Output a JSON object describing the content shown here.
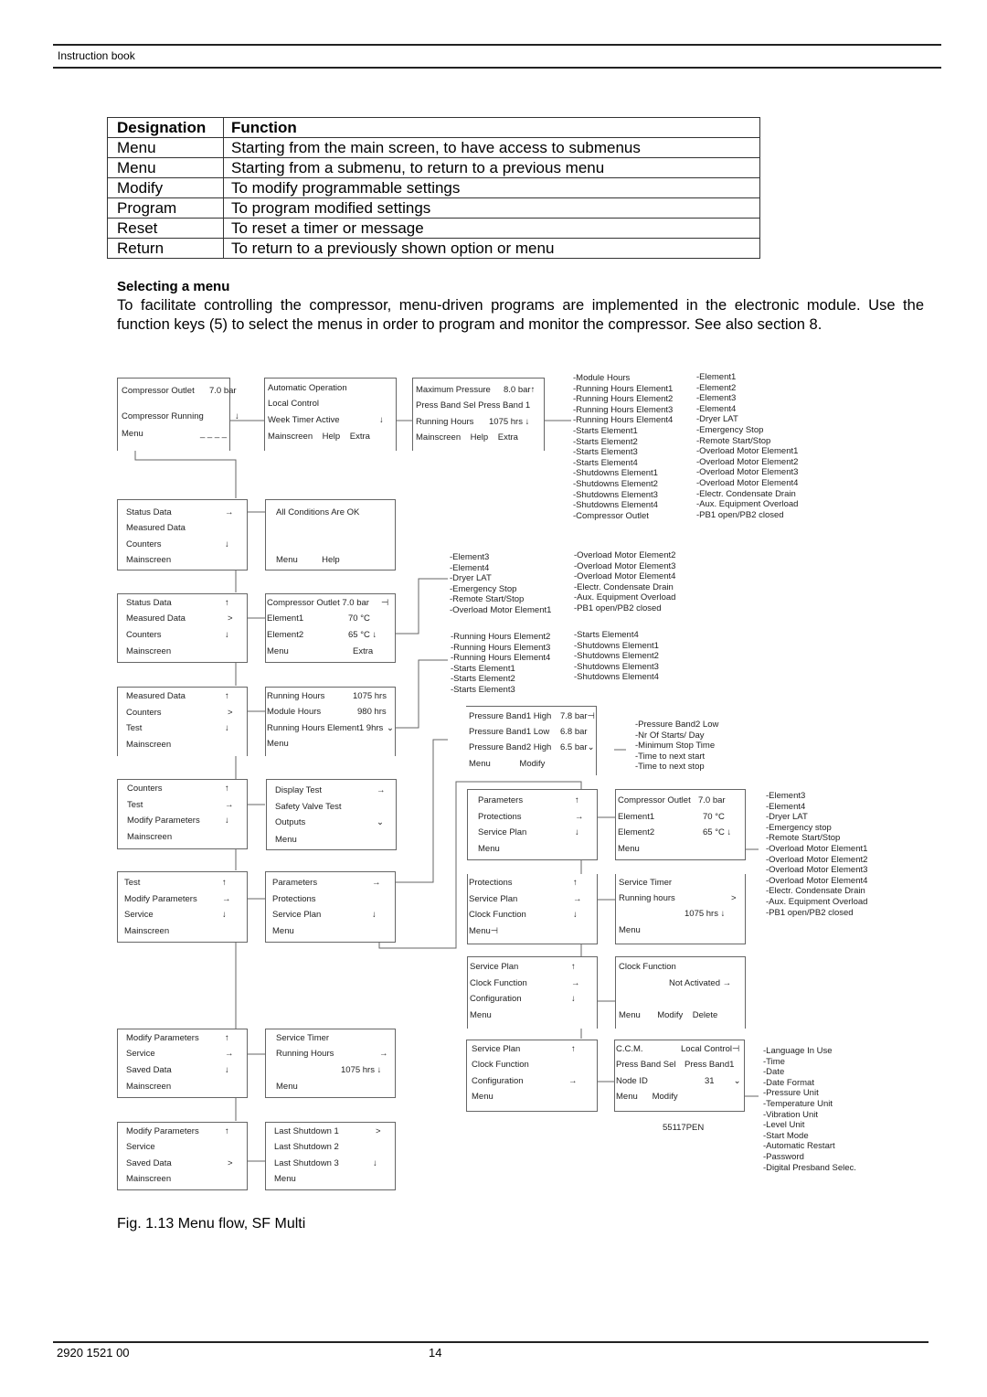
{
  "header": {
    "title": "Instruction book"
  },
  "function_table": {
    "columns": [
      "Designation",
      "Function"
    ],
    "rows": [
      [
        "Menu",
        "Starting from the main screen, to have access to submenus"
      ],
      [
        "Menu",
        "Starting from a submenu, to return to a previous menu"
      ],
      [
        "Modify",
        "To modify programmable settings"
      ],
      [
        "Program",
        "To program modified settings"
      ],
      [
        "Reset",
        "To reset a timer or message"
      ],
      [
        "Return",
        "To return to a previously shown option or menu"
      ]
    ]
  },
  "section": {
    "title": "Selecting a menu",
    "body": "To facilitate controlling the compressor, menu-driven programs are implemented in the electronic module. Use the function keys (5) to select the menus in order to program and monitor the compressor.  See also section 8."
  },
  "diagram": {
    "screens": {
      "main": [
        [
          "Compressor Outlet",
          "7.0 bar"
        ],
        [
          "",
          ""
        ],
        [
          "Compressor Running",
          "↓"
        ],
        [
          "Menu",
          "_ _ _ _"
        ]
      ],
      "auto_op": [
        [
          "Automatic  Operation",
          ""
        ],
        [
          "Local Control",
          ""
        ],
        [
          "Week Timer Active",
          "↓"
        ],
        [
          "Mainscreen    Help    Extra",
          ""
        ]
      ],
      "max_pressure": [
        [
          "Maximum Pressure",
          "8.0 bar↑"
        ],
        [
          "Press Band Sel  Press Band 1",
          ""
        ],
        [
          "Running Hours",
          "1075 hrs  ↓"
        ],
        [
          "Mainscreen    Help    Extra",
          ""
        ]
      ],
      "status_menu": [
        [
          "Status Data",
          "→"
        ],
        [
          "Measured Data",
          ""
        ],
        [
          "Counters",
          "↓"
        ],
        [
          "Mainscreen",
          ""
        ]
      ],
      "all_ok": [
        [
          "All Conditions Are OK",
          ""
        ],
        [
          "",
          ""
        ],
        [
          "",
          ""
        ],
        [
          "Menu          Help",
          ""
        ]
      ],
      "measured_menu": [
        [
          "Status Data",
          "↑"
        ],
        [
          "Measured Data",
          ">"
        ],
        [
          "Counters",
          "↓"
        ],
        [
          "Mainscreen",
          ""
        ]
      ],
      "measured_screen": [
        [
          "Compressor Outlet 7.0 bar",
          "⊣"
        ],
        [
          "Element1",
          "70 °C"
        ],
        [
          "Element2",
          "65 °C  ↓"
        ],
        [
          "Menu",
          "Extra"
        ]
      ],
      "counters_menu": [
        [
          "Measured Data",
          "↑"
        ],
        [
          "Counters",
          ">"
        ],
        [
          "Test",
          "↓"
        ],
        [
          "Mainscreen",
          ""
        ]
      ],
      "counters_screen": [
        [
          "Running Hours",
          "1075 hrs"
        ],
        [
          "Module Hours",
          "980 hrs"
        ],
        [
          "Running Hours Element1  9hrs",
          "⌄"
        ],
        [
          "Menu",
          ""
        ]
      ],
      "test_menu": [
        [
          "Counters",
          "↑"
        ],
        [
          "Test",
          "→"
        ],
        [
          "Modify Parameters",
          "↓"
        ],
        [
          "Mainscreen",
          ""
        ]
      ],
      "test_screen": [
        [
          "Display Test",
          "→"
        ],
        [
          "Safety Valve Test",
          ""
        ],
        [
          "Outputs",
          "⌄"
        ],
        [
          "Menu",
          ""
        ]
      ],
      "modify_menu": [
        [
          "Test",
          "↑"
        ],
        [
          "Modify Parameters",
          "→"
        ],
        [
          "Service",
          "↓"
        ],
        [
          "Mainscreen",
          ""
        ]
      ],
      "modify_screen": [
        [
          "Parameters",
          "→"
        ],
        [
          "Protections",
          ""
        ],
        [
          "Service Plan",
          "↓"
        ],
        [
          "Menu",
          ""
        ]
      ],
      "pressure_band": [
        [
          "Pressure Band1 High",
          "7.8 bar⊣"
        ],
        [
          "Pressure Band1 Low",
          "6.8 bar"
        ],
        [
          "Pressure Band2 High",
          "6.5 bar⌄"
        ],
        [
          "Menu            Modify",
          ""
        ]
      ],
      "protections_menu": [
        [
          "Parameters",
          "↑"
        ],
        [
          "Protections",
          "→"
        ],
        [
          "Service Plan",
          "↓"
        ],
        [
          "Menu",
          ""
        ]
      ],
      "protections_screen": [
        [
          "Compressor Outlet",
          "7.0 bar"
        ],
        [
          "Element1",
          "70 °C"
        ],
        [
          "Element2",
          "65 °C  ↓"
        ],
        [
          "Menu",
          ""
        ]
      ],
      "service_plan_menu": [
        [
          "Protections",
          "↑"
        ],
        [
          "Service Plan",
          "→"
        ],
        [
          "Clock Function",
          "↓"
        ],
        [
          "Menu⊣",
          ""
        ]
      ],
      "service_plan_screen": [
        [
          "Service Timer",
          ""
        ],
        [
          "Running hours",
          ">"
        ],
        [
          "",
          "1075 hrs  ↓"
        ],
        [
          "Menu",
          ""
        ]
      ],
      "clock_menu": [
        [
          "Service Plan",
          "↑"
        ],
        [
          "Clock Function",
          "→"
        ],
        [
          "Configuration",
          "↓"
        ],
        [
          "Menu",
          ""
        ]
      ],
      "clock_screen": [
        [
          "Clock Function",
          ""
        ],
        [
          "",
          "Not Activated  →"
        ],
        [
          "",
          ""
        ],
        [
          "Menu       Modify    Delete",
          ""
        ]
      ],
      "config_menu": [
        [
          "Service Plan",
          "↑"
        ],
        [
          "Clock Function",
          ""
        ],
        [
          "Configuration",
          "→"
        ],
        [
          "Menu",
          ""
        ]
      ],
      "config_screen": [
        [
          "C.C.M.",
          "Local Control⊣"
        ],
        [
          "Press Band Sel",
          "Press Band1"
        ],
        [
          "Node ID",
          "31        ⌄"
        ],
        [
          "Menu      Modify",
          ""
        ]
      ],
      "service_menu": [
        [
          "Modify Parameters",
          "↑"
        ],
        [
          "Service",
          "→"
        ],
        [
          "Saved Data",
          "↓"
        ],
        [
          "Mainscreen",
          ""
        ]
      ],
      "service_screen": [
        [
          "Service Timer",
          ""
        ],
        [
          "Running Hours",
          "→"
        ],
        [
          "",
          "1075 hrs ↓"
        ],
        [
          "Menu",
          ""
        ]
      ],
      "saved_menu": [
        [
          "Modify Parameters",
          "↑"
        ],
        [
          "Service",
          ""
        ],
        [
          "Saved Data",
          ">"
        ],
        [
          "Mainscreen",
          ""
        ]
      ],
      "saved_screen": [
        [
          "Last Shutdown 1",
          ">"
        ],
        [
          "Last Shutdown 2",
          ""
        ],
        [
          "Last Shutdown 3",
          "↓"
        ],
        [
          "Menu",
          ""
        ]
      ]
    },
    "lists": {
      "counters_top": [
        "-Module Hours",
        "-Running Hours  Element1",
        "-Running Hours  Element2",
        "-Running Hours  Element3",
        "-Running Hours  Element4",
        "-Starts Element1",
        "-Starts Element2",
        "-Starts Element3",
        "-Starts Element4",
        "-Shutdowns Element1",
        "-Shutdowns Element2",
        "-Shutdowns Element3",
        "-Shutdowns Element4",
        "-Compressor Outlet"
      ],
      "status_top": [
        "-Element1",
        "-Element2",
        "-Element3",
        "-Element4",
        "-Dryer LAT",
        "-Emergency Stop",
        "-Remote Start/Stop",
        "-Overload Motor Element1",
        "-Overload Motor Element2",
        "-Overload Motor Element3",
        "-Overload Motor Element4",
        "-Electr. Condensate Drain",
        "-Aux. Equipment Overload",
        "-PB1 open/PB2 closed"
      ],
      "measured_a": [
        "-Element3",
        "-Element4",
        "-Dryer LAT",
        "-Emergency Stop",
        "-Remote Start/Stop",
        "-Overload Motor Element1"
      ],
      "measured_b": [
        "-Overload Motor Element2",
        "-Overload Motor Element3",
        "-Overload Motor Element4",
        "-Electr. Condensate Drain",
        "-Aux. Equipment Overload",
        "-PB1 open/PB2 closed"
      ],
      "counters_a": [
        "-Running Hours Element2",
        "-Running Hours Element3",
        "-Running Hours Element4",
        "-Starts Element1",
        "-Starts Element2",
        "-Starts Element3"
      ],
      "counters_b": [
        "-Starts Element4",
        "-Shutdowns Element1",
        "-Shutdowns Element2",
        "-Shutdowns Element3",
        "-Shutdowns Element4"
      ],
      "pressure_more": [
        "-Pressure Band2 Low",
        "-Nr Of Starts/ Day",
        "-Minimum Stop Time",
        "-Time to next start",
        "-Time to next stop"
      ],
      "protections_more": [
        "-Element3",
        "-Element4",
        "-Dryer LAT",
        "-Emergency stop",
        "-Remote Start/Stop",
        "-Overload Motor Element1",
        "-Overload Motor Element2",
        "-Overload Motor Element3",
        "-Overload Motor Element4",
        "-Electr. Condensate Drain",
        "-Aux. Equipment Overload",
        "-PB1 open/PB2 closed"
      ],
      "config_more": [
        "-Language In Use",
        "-Time",
        "-Date",
        "-Date Format",
        "-Pressure Unit",
        "-Temperature Unit",
        "-Vibration Unit",
        "-Level Unit",
        "-Start Mode",
        "-Automatic Restart",
        "-Password",
        "-Digital Presband Selec."
      ]
    },
    "drawing_code": "55117PEN"
  },
  "caption": "Fig. 1.13 Menu flow, SF Multi",
  "footer": {
    "doc_number": "2920 1521 00",
    "page": "14"
  }
}
